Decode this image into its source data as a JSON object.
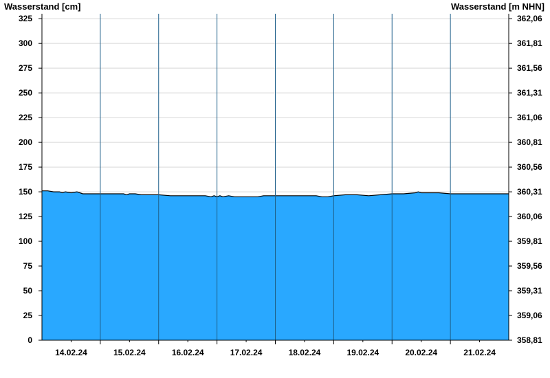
{
  "chart_data": {
    "type": "area",
    "ylabel_left": "Wasserstand [cm]",
    "ylabel_right": "Wasserstand [m NHN]",
    "ylim": [
      0,
      330
    ],
    "yticks_left": [
      0,
      25,
      50,
      75,
      100,
      125,
      150,
      175,
      200,
      225,
      250,
      275,
      300,
      325
    ],
    "yticks_right": [
      "358,81",
      "359,06",
      "359,31",
      "359,56",
      "359,81",
      "360,06",
      "360,31",
      "360,56",
      "360,81",
      "361,06",
      "361,31",
      "361,56",
      "361,81",
      "362,06"
    ],
    "x_labels": [
      "14.02.24",
      "15.02.24",
      "16.02.24",
      "17.02.24",
      "18.02.24",
      "19.02.24",
      "20.02.24",
      "21.02.24"
    ],
    "xlim_days": [
      0,
      8
    ],
    "grid": true,
    "fill_color": "#29a8ff",
    "line_color": "#000000",
    "series": [
      {
        "x_days": [
          0,
          0.1,
          0.2,
          0.3,
          0.35,
          0.4,
          0.5,
          0.6,
          0.65,
          0.7,
          0.8,
          0.9,
          1.0,
          1.2,
          1.4,
          1.45,
          1.5,
          1.6,
          1.7,
          1.8,
          1.9,
          2.0,
          2.2,
          2.4,
          2.6,
          2.8,
          2.9,
          2.95,
          3.0,
          3.05,
          3.1,
          3.2,
          3.3,
          3.4,
          3.5,
          3.6,
          3.7,
          3.8,
          4.0,
          4.2,
          4.4,
          4.6,
          4.7,
          4.8,
          4.9,
          5.0,
          5.2,
          5.4,
          5.6,
          5.8,
          6.0,
          6.2,
          6.4,
          6.45,
          6.5,
          6.6,
          6.8,
          7.0,
          7.2,
          7.4,
          7.6,
          7.8,
          8.0
        ],
        "y": [
          151,
          151,
          150,
          150,
          149,
          150,
          149,
          150,
          149,
          148,
          148,
          148,
          148,
          148,
          148,
          147,
          148,
          148,
          147,
          147,
          147,
          147,
          146,
          146,
          146,
          146,
          145,
          146,
          145,
          146,
          145,
          146,
          145,
          145,
          145,
          145,
          145,
          146,
          146,
          146,
          146,
          146,
          146,
          145,
          145,
          146,
          147,
          147,
          146,
          147,
          148,
          148,
          149,
          150,
          149,
          149,
          149,
          148,
          148,
          148,
          148,
          148,
          148
        ]
      }
    ]
  }
}
